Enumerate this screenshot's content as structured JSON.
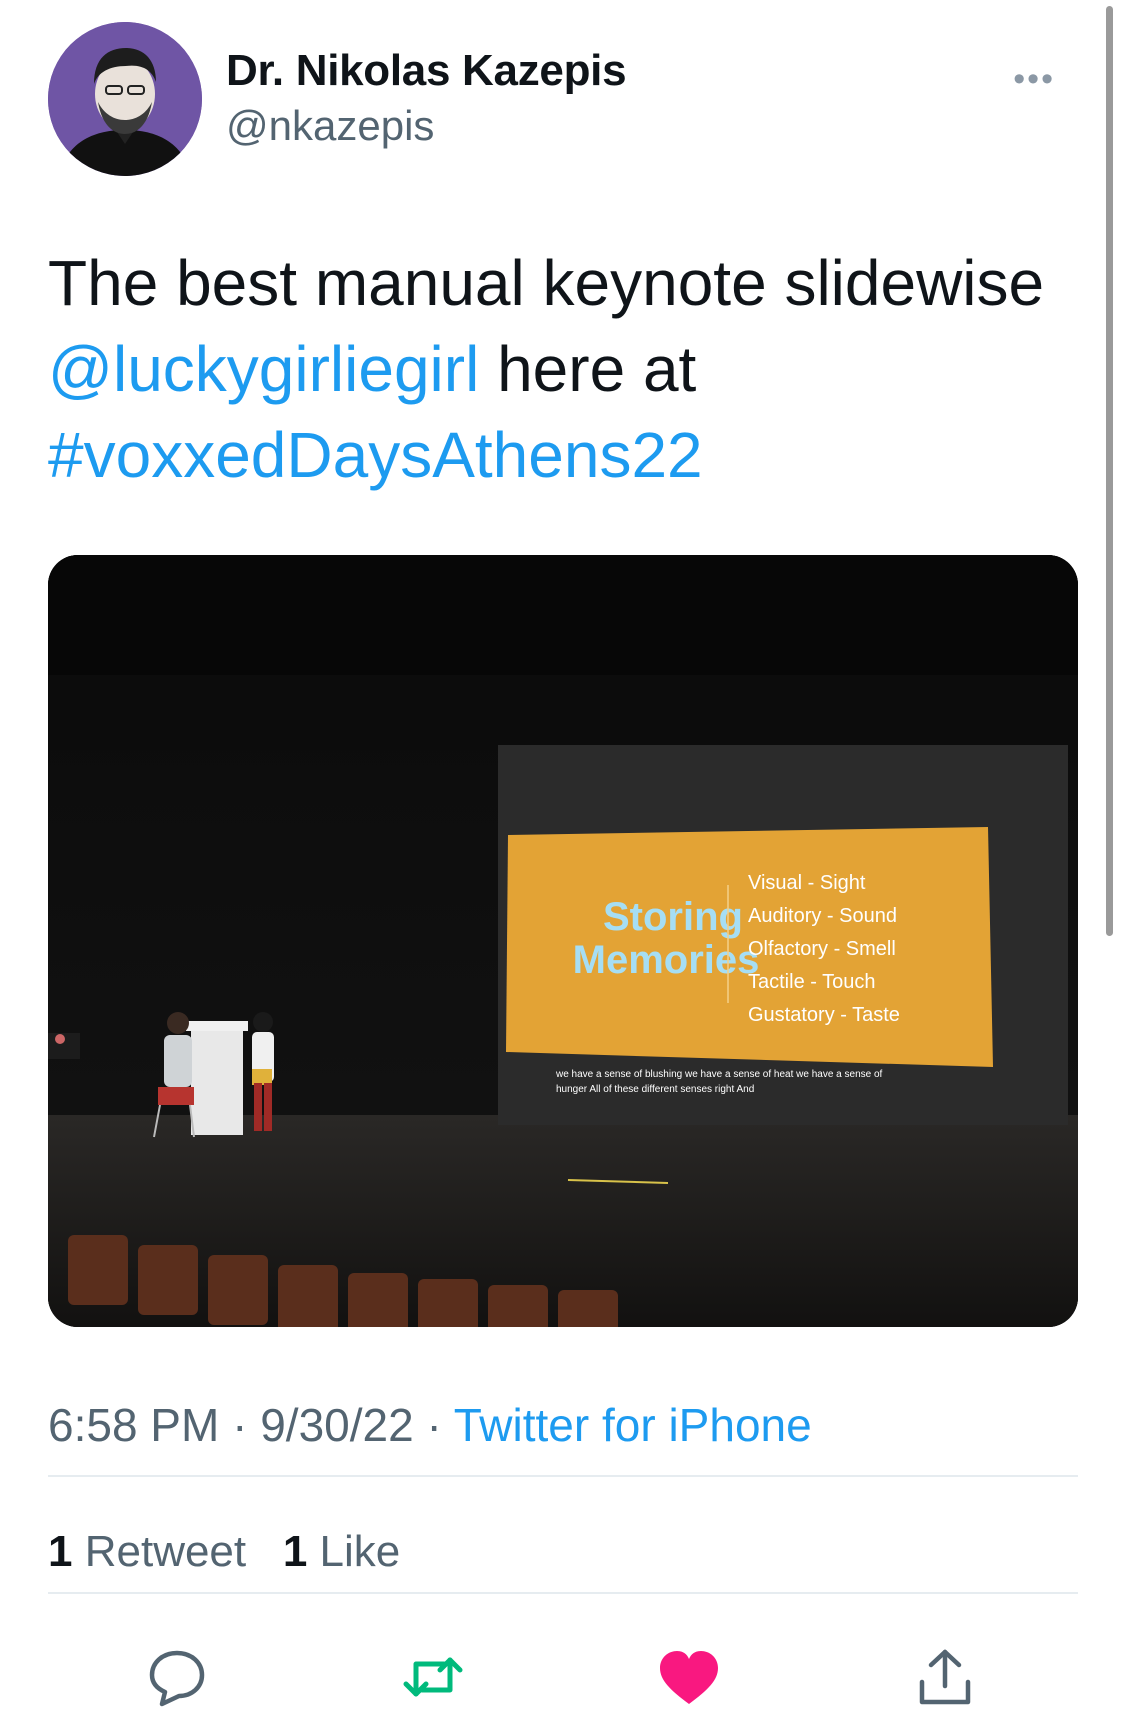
{
  "author": {
    "name": "Dr. Nikolas Kazepis",
    "handle": "@nkazepis"
  },
  "tweet": {
    "text_line1": "The best manual keynote slidewise",
    "mention": "@luckygirliegirl",
    "text_line2_rest": " here at",
    "hashtag": "#voxxedDaysAthens22"
  },
  "media": {
    "slide_title_line1": "Storing",
    "slide_title_line2": "Memories",
    "slide_senses": [
      "Visual - Sight",
      "Auditory - Sound",
      "Olfactory - Smell",
      "Tactile - Touch",
      "Gustatory - Taste"
    ],
    "caption_line1": "we have a sense of blushing we have a sense of heat we have a sense of",
    "caption_line2": "hunger All of these different senses right And"
  },
  "meta": {
    "time": "6:58 PM",
    "date": "9/30/22",
    "source": "Twitter for iPhone",
    "separator": " · "
  },
  "stats": {
    "retweets_count": "1",
    "retweets_label": "Retweet",
    "likes_count": "1",
    "likes_label": "Like"
  },
  "actions": {
    "reply_icon": "speech-bubble-icon",
    "retweet_icon": "retweet-arrows-icon",
    "like_icon": "heart-icon",
    "share_icon": "share-upload-icon"
  },
  "colors": {
    "link": "#1d9bf0",
    "retweet_green": "#00ba7c",
    "like_pink": "#f91880",
    "secondary_text": "#536471",
    "avatar_bg": "#6f55a5",
    "slide_orange": "#e3a335",
    "slide_title": "#a6def4"
  },
  "more_icon": "ellipsis-icon"
}
